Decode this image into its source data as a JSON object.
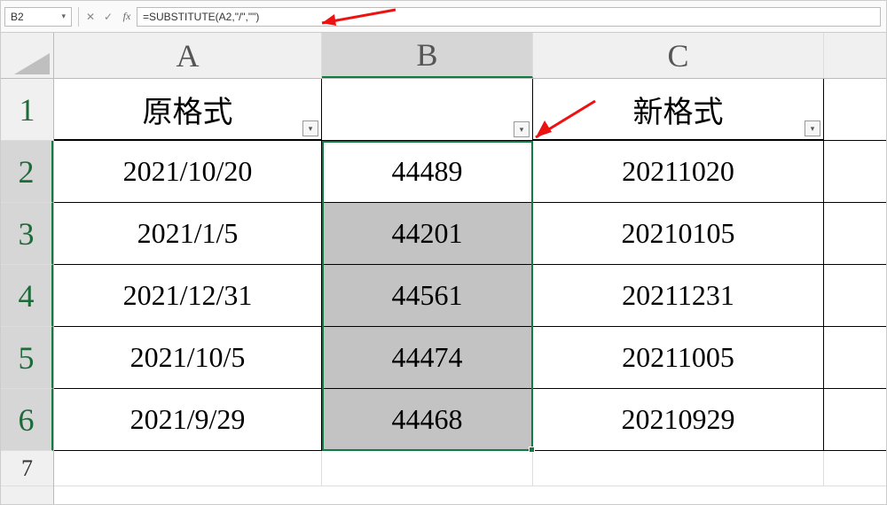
{
  "formula_bar": {
    "cell_ref": "B2",
    "cancel_icon": "✕",
    "confirm_icon": "✓",
    "fx_label": "fx",
    "formula": "=SUBSTITUTE(A2,\"/\",\"\")"
  },
  "columns": [
    "A",
    "B",
    "C"
  ],
  "rows": [
    "1",
    "2",
    "3",
    "4",
    "5",
    "6",
    "7"
  ],
  "headers": {
    "A": "原格式",
    "B": "",
    "C": "新格式"
  },
  "data": [
    {
      "A": "2021/10/20",
      "B": "44489",
      "C": "20211020"
    },
    {
      "A": "2021/1/5",
      "B": "44201",
      "C": "20210105"
    },
    {
      "A": "2021/12/31",
      "B": "44561",
      "C": "20211231"
    },
    {
      "A": "2021/10/5",
      "B": "44474",
      "C": "20211005"
    },
    {
      "A": "2021/9/29",
      "B": "44468",
      "C": "20210929"
    }
  ],
  "filter_glyph": "▾"
}
